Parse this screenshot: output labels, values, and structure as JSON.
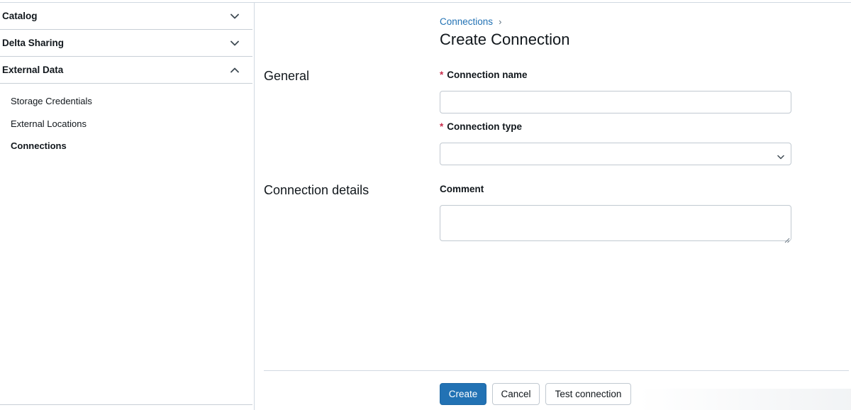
{
  "sidebar": {
    "sections": [
      {
        "label": "Catalog",
        "expanded": false,
        "icon": "chevron-down-icon"
      },
      {
        "label": "Delta Sharing",
        "expanded": false,
        "icon": "chevron-down-icon"
      },
      {
        "label": "External Data",
        "expanded": true,
        "icon": "chevron-up-icon"
      }
    ],
    "external_data_items": [
      {
        "label": "Storage Credentials",
        "active": false
      },
      {
        "label": "External Locations",
        "active": false
      },
      {
        "label": "Connections",
        "active": true
      }
    ]
  },
  "breadcrumb": {
    "parent": "Connections",
    "separator": "›"
  },
  "page": {
    "title": "Create Connection"
  },
  "sections": {
    "general": "General",
    "details": "Connection details"
  },
  "form": {
    "required_marker": "*",
    "connection_name": {
      "label": "Connection name",
      "value": ""
    },
    "connection_type": {
      "label": "Connection type",
      "value": ""
    },
    "comment": {
      "label": "Comment",
      "value": ""
    }
  },
  "buttons": {
    "create": "Create",
    "cancel": "Cancel",
    "test": "Test connection"
  },
  "colors": {
    "accent": "#2272b4",
    "required": "#c82d4c",
    "border": "#c1c9d1",
    "text": "#11171c"
  }
}
